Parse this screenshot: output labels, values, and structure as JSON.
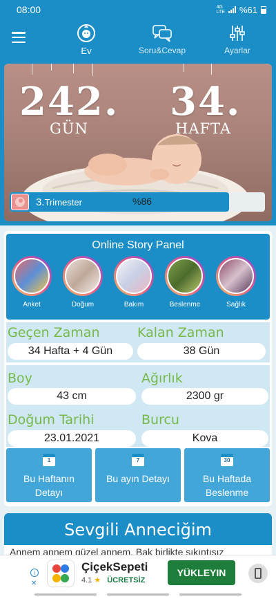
{
  "status_bar": {
    "time": "08:00",
    "network": "4G LTE",
    "battery": "%61"
  },
  "nav": {
    "tabs": [
      {
        "label": "Ev",
        "icon": "baby-face-icon",
        "active": true
      },
      {
        "label": "Soru&Cevap",
        "icon": "chat-bubbles-icon",
        "active": false
      },
      {
        "label": "Ayarlar",
        "icon": "sliders-icon",
        "active": false
      }
    ]
  },
  "hero": {
    "days_value": "242.",
    "days_unit": "GÜN",
    "weeks_value": "34.",
    "weeks_unit": "HAFTA",
    "trimester_number": "3.",
    "trimester_label": "Trimester",
    "progress_text": "%86",
    "progress": 0.86
  },
  "story_panel": {
    "title": "Online Story Panel",
    "items": [
      {
        "label": "Anket"
      },
      {
        "label": "Doğum"
      },
      {
        "label": "Bakım"
      },
      {
        "label": "Beslenme"
      },
      {
        "label": "Sağlık"
      }
    ]
  },
  "stats": {
    "elapsed_title": "Geçen Zaman",
    "elapsed_value": "34 Hafta + 4 Gün",
    "remaining_title": "Kalan Zaman",
    "remaining_value": "38 Gün",
    "height_title": "Boy",
    "height_value": "43 cm",
    "weight_title": "Ağırlık",
    "weight_value": "2300 gr",
    "birth_date_title": "Doğum Tarihi",
    "birth_date_value": "23.01.2021",
    "zodiac_title": "Burcu",
    "zodiac_value": "Kova"
  },
  "buttons": [
    {
      "day": "1",
      "label": "Bu Haftanın Detayı"
    },
    {
      "day": "7",
      "label": "Bu ayın Detayı"
    },
    {
      "day": "30",
      "label": "Bu Haftada Beslenme"
    }
  ],
  "letter": {
    "title": "Sevgili Anneciğim",
    "text": "Annem annem güzel annem. Bak birlikte sıkıntısız"
  },
  "ad": {
    "app_name": "ÇiçekSepeti",
    "rating": "4.1",
    "price": "ÜCRETSİZ",
    "cta": "YÜKLEYIN"
  },
  "colors": {
    "primary": "#1c8ec7",
    "accent_green": "#77b84a",
    "button_blue": "#43a6d8",
    "cta_green": "#1e7d3a"
  }
}
